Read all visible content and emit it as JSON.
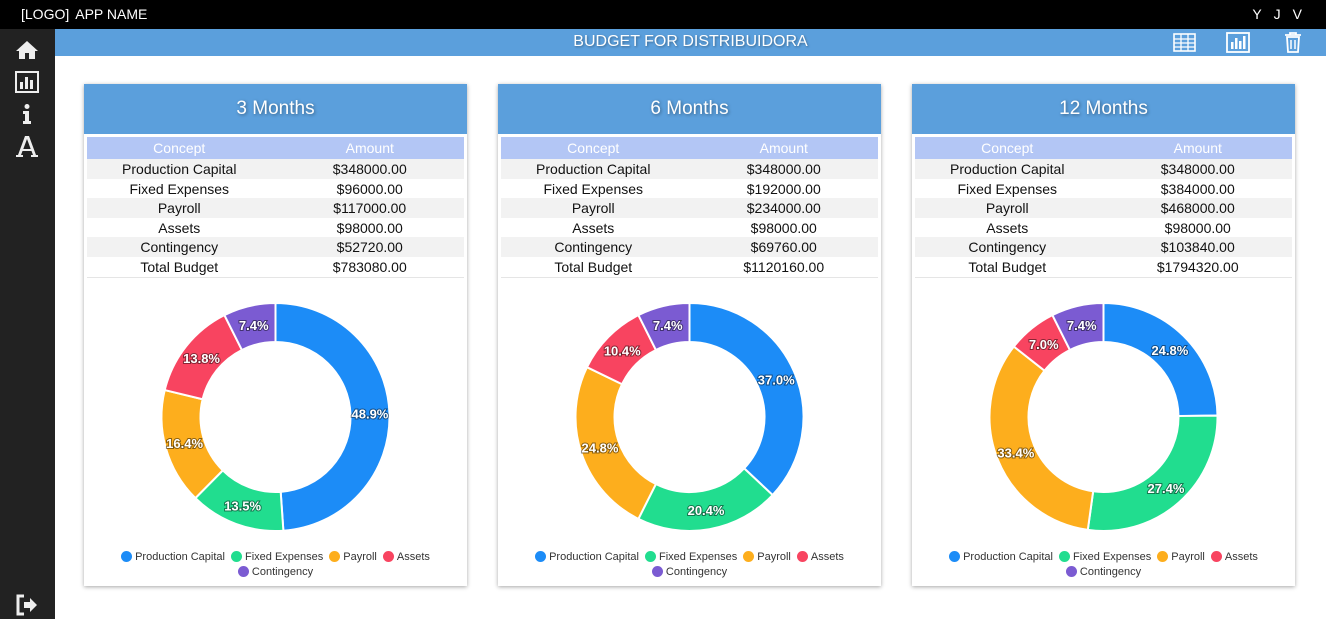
{
  "app": {
    "logo": "[LOGO]",
    "name": "APP NAME"
  },
  "users": [
    "Y",
    "J",
    "V"
  ],
  "sidebar": {
    "items": [
      "home-icon",
      "bar-chart-icon",
      "info-icon",
      "font-icon"
    ],
    "footer": "logout-icon"
  },
  "header": {
    "title": "BUDGET FOR DISTRIBUIDORA",
    "icons": [
      "table-icon",
      "chart-icon",
      "trash-icon"
    ]
  },
  "colors": {
    "accent": "#5b9fdc",
    "production": "#1c8cf7",
    "fixed": "#21dd8f",
    "payroll": "#fdae1d",
    "assets": "#f84460",
    "contingency": "#7b5bd2"
  },
  "table_headers": [
    "Concept",
    "Amount"
  ],
  "cards": [
    {
      "title": "3 Months",
      "rows": [
        {
          "concept": "Production Capital",
          "amount": "$348000.00"
        },
        {
          "concept": "Fixed Expenses",
          "amount": "$96000.00"
        },
        {
          "concept": "Payroll",
          "amount": "$117000.00"
        },
        {
          "concept": "Assets",
          "amount": "$98000.00"
        },
        {
          "concept": "Contingency",
          "amount": "$52720.00"
        },
        {
          "concept": "Total Budget",
          "amount": "$783080.00"
        }
      ]
    },
    {
      "title": "6 Months",
      "rows": [
        {
          "concept": "Production Capital",
          "amount": "$348000.00"
        },
        {
          "concept": "Fixed Expenses",
          "amount": "$192000.00"
        },
        {
          "concept": "Payroll",
          "amount": "$234000.00"
        },
        {
          "concept": "Assets",
          "amount": "$98000.00"
        },
        {
          "concept": "Contingency",
          "amount": "$69760.00"
        },
        {
          "concept": "Total Budget",
          "amount": "$1120160.00"
        }
      ]
    },
    {
      "title": "12 Months",
      "rows": [
        {
          "concept": "Production Capital",
          "amount": "$348000.00"
        },
        {
          "concept": "Fixed Expenses",
          "amount": "$384000.00"
        },
        {
          "concept": "Payroll",
          "amount": "$468000.00"
        },
        {
          "concept": "Assets",
          "amount": "$98000.00"
        },
        {
          "concept": "Contingency",
          "amount": "$103840.00"
        },
        {
          "concept": "Total Budget",
          "amount": "$1794320.00"
        }
      ]
    }
  ],
  "chart_data": [
    {
      "type": "pie",
      "categories": [
        "Production Capital",
        "Fixed Expenses",
        "Payroll",
        "Assets",
        "Contingency"
      ],
      "values": [
        48.9,
        13.5,
        16.4,
        13.8,
        7.4
      ],
      "labels": [
        "48.9%",
        "13.5%",
        "16.4%",
        "13.8%",
        "7.4%"
      ],
      "legend": "bottom"
    },
    {
      "type": "pie",
      "categories": [
        "Production Capital",
        "Fixed Expenses",
        "Payroll",
        "Assets",
        "Contingency"
      ],
      "values": [
        37.0,
        20.4,
        24.8,
        10.4,
        7.4
      ],
      "labels": [
        "37.0%",
        "20.4%",
        "24.8%",
        "10.4%",
        "7.4%"
      ],
      "legend": "bottom"
    },
    {
      "type": "pie",
      "categories": [
        "Production Capital",
        "Fixed Expenses",
        "Payroll",
        "Assets",
        "Contingency"
      ],
      "values": [
        24.8,
        27.4,
        33.4,
        7.0,
        7.4
      ],
      "labels": [
        "24.8%",
        "27.4%",
        "33.4%",
        "7.0%",
        "7.4%"
      ],
      "legend": "bottom"
    }
  ]
}
